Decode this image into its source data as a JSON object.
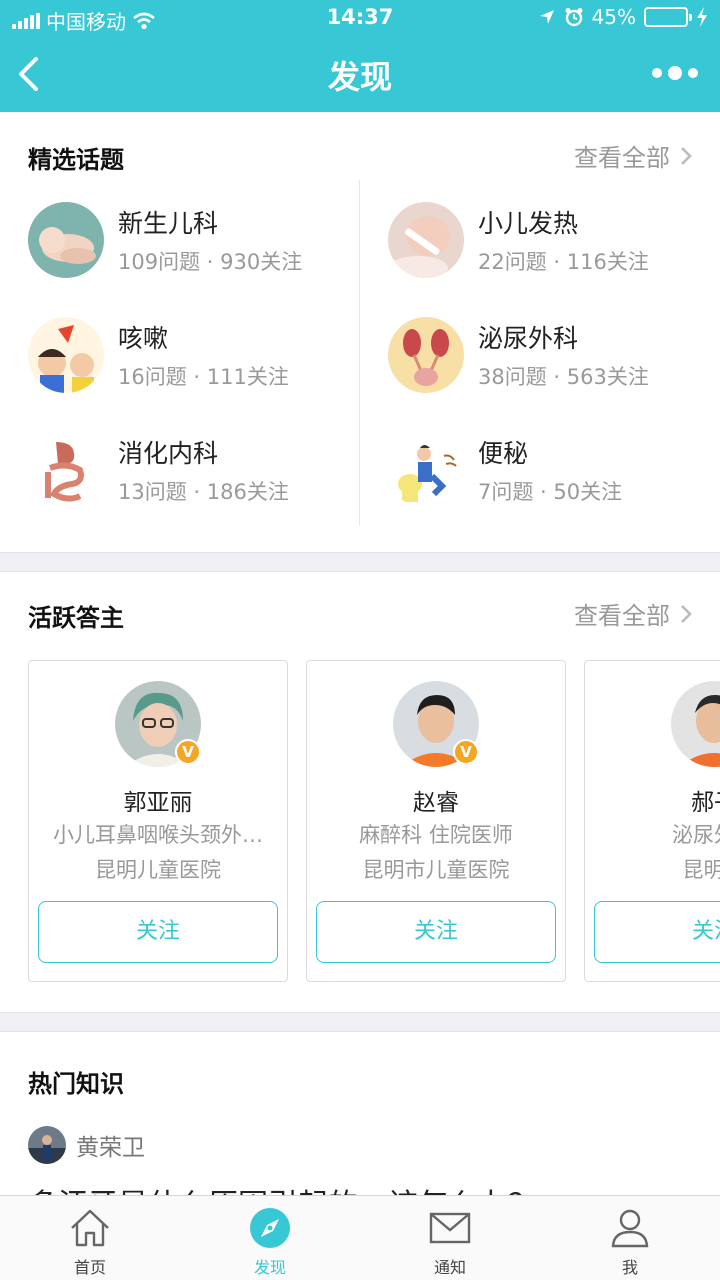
{
  "status_bar": {
    "carrier": "中国移动",
    "time": "14:37",
    "battery": "45%",
    "battery_level": 0.45
  },
  "nav": {
    "title": "发现"
  },
  "topics_section": {
    "title": "精选话题",
    "view_all": "查看全部",
    "items": [
      {
        "name": "新生儿科",
        "meta": "109问题 · 930关注",
        "icon": "newborn-photo"
      },
      {
        "name": "小儿发热",
        "meta": "22问题 · 116关注",
        "icon": "fever-photo"
      },
      {
        "name": "咳嗽",
        "meta": "16问题 · 111关注",
        "icon": "cough-illustration"
      },
      {
        "name": "泌尿外科",
        "meta": "38问题 · 563关注",
        "icon": "urinary-illustration"
      },
      {
        "name": "消化内科",
        "meta": "13问题 · 186关注",
        "icon": "digestive-illustration"
      },
      {
        "name": "便秘",
        "meta": "7问题 · 50关注",
        "icon": "constipation-illustration"
      }
    ]
  },
  "experts_section": {
    "title": "活跃答主",
    "view_all": "查看全部",
    "verified_mark": "V",
    "cards": [
      {
        "name": "郭亚丽",
        "dept": "小儿耳鼻咽喉头颈外…",
        "hospital": "昆明儿童医院",
        "follow": "关注"
      },
      {
        "name": "赵睿",
        "dept": "麻醉科 住院医师",
        "hospital": "昆明市儿童医院",
        "follow": "关注"
      },
      {
        "name": "郝子",
        "dept": "泌尿外科",
        "hospital": "昆明儿",
        "follow": "关注"
      }
    ]
  },
  "knowledge_section": {
    "title": "热门知识",
    "author": "黄荣卫",
    "article_title": "多汗牙是什么原因引起的，该怎么办？"
  },
  "tabbar": {
    "items": [
      {
        "label": "首页",
        "icon": "home-icon"
      },
      {
        "label": "发现",
        "icon": "compass-icon"
      },
      {
        "label": "通知",
        "icon": "mail-icon"
      },
      {
        "label": "我",
        "icon": "person-icon"
      }
    ]
  },
  "colors": {
    "accent": "#38c7d4",
    "verified": "#f5a623",
    "muted_text": "#999999",
    "section_gap": "#efeff4"
  }
}
